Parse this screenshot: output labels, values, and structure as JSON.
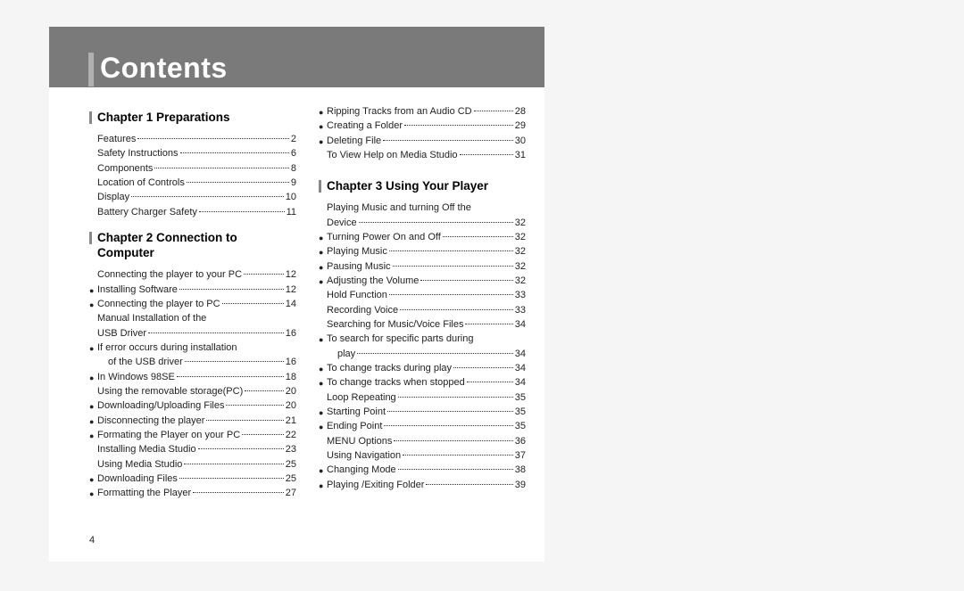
{
  "title": "Contents",
  "page_number": "4",
  "col1": {
    "chapters": [
      {
        "heading": "Chapter 1  Preparations",
        "entries": [
          {
            "label": "Features",
            "page": "2",
            "bullet": false
          },
          {
            "label": "Safety Instructions",
            "page": "6",
            "bullet": false
          },
          {
            "label": "Components",
            "page": "8",
            "bullet": false
          },
          {
            "label": "Location of Controls",
            "page": "9",
            "bullet": false
          },
          {
            "label": "Display",
            "page": "10",
            "bullet": false
          },
          {
            "label": "Battery Charger Safety",
            "page": "11",
            "bullet": false
          }
        ]
      },
      {
        "heading": "Chapter 2  Connection to Computer",
        "entries": [
          {
            "label": "Connecting the player to your PC",
            "page": "12",
            "bullet": false
          },
          {
            "label": "Installing Software",
            "page": "12",
            "bullet": true
          },
          {
            "label": "Connecting the player to PC",
            "page": "14",
            "bullet": true
          },
          {
            "label": "Manual Installation of the",
            "cont": true,
            "bullet": false
          },
          {
            "label": "USB Driver",
            "page": "16",
            "bullet": false
          },
          {
            "label": "If error occurs during installation",
            "cont": true,
            "bullet": true
          },
          {
            "label": "of the USB driver",
            "page": "16",
            "bullet": false,
            "indent2": true
          },
          {
            "label": "In Windows 98SE",
            "page": "18",
            "bullet": true
          },
          {
            "label": "Using the removable storage(PC)",
            "page": "20",
            "bullet": false
          },
          {
            "label": "Downloading/Uploading Files",
            "page": "20",
            "bullet": true
          },
          {
            "label": "Disconnecting the player",
            "page": "21",
            "bullet": true
          },
          {
            "label": "Formating the Player on your PC",
            "page": "22",
            "bullet": true
          },
          {
            "label": "Installing Media Studio",
            "page": "23",
            "bullet": false
          },
          {
            "label": "Using Media Studio",
            "page": "25",
            "bullet": false
          },
          {
            "label": "Downloading Files",
            "page": "25",
            "bullet": true
          },
          {
            "label": "Formatting the Player",
            "page": "27",
            "bullet": true
          }
        ]
      }
    ]
  },
  "col2": {
    "pre_entries": [
      {
        "label": "Ripping Tracks from an Audio CD",
        "page": "28",
        "bullet": true
      },
      {
        "label": "Creating a Folder",
        "page": "29",
        "bullet": true
      },
      {
        "label": "Deleting File",
        "page": "30",
        "bullet": true
      },
      {
        "label": "To View Help on Media Studio",
        "page": "31",
        "bullet": false
      }
    ],
    "chapters": [
      {
        "heading": "Chapter 3  Using Your Player",
        "entries": [
          {
            "label": "Playing Music and turning Off the",
            "cont": true,
            "bullet": false
          },
          {
            "label": "Device",
            "page": "32",
            "bullet": false
          },
          {
            "label": "Turning Power On and Off",
            "page": "32",
            "bullet": true
          },
          {
            "label": "Playing Music",
            "page": "32",
            "bullet": true
          },
          {
            "label": "Pausing Music",
            "page": "32",
            "bullet": true
          },
          {
            "label": "Adjusting the Volume",
            "page": "32",
            "bullet": true
          },
          {
            "label": "Hold Function",
            "page": "33",
            "bullet": false
          },
          {
            "label": "Recording Voice",
            "page": "33",
            "bullet": false
          },
          {
            "label": "Searching for Music/Voice Files",
            "page": "34",
            "bullet": false
          },
          {
            "label": "To search for specific parts during",
            "cont": true,
            "bullet": true
          },
          {
            "label": "play",
            "page": "34",
            "bullet": false,
            "indent2": true
          },
          {
            "label": "To change tracks during play",
            "page": "34",
            "bullet": true
          },
          {
            "label": "To change tracks when stopped",
            "page": "34",
            "bullet": true
          },
          {
            "label": "Loop Repeating",
            "page": "35",
            "bullet": false
          },
          {
            "label": "Starting Point",
            "page": "35",
            "bullet": true
          },
          {
            "label": "Ending Point",
            "page": "35",
            "bullet": true
          },
          {
            "label": "MENU Options",
            "page": "36",
            "bullet": false
          },
          {
            "label": "Using Navigation",
            "page": "37",
            "bullet": false
          },
          {
            "label": "Changing Mode",
            "page": "38",
            "bullet": true
          },
          {
            "label": "Playing /Exiting Folder",
            "page": "39",
            "bullet": true
          }
        ]
      }
    ]
  }
}
